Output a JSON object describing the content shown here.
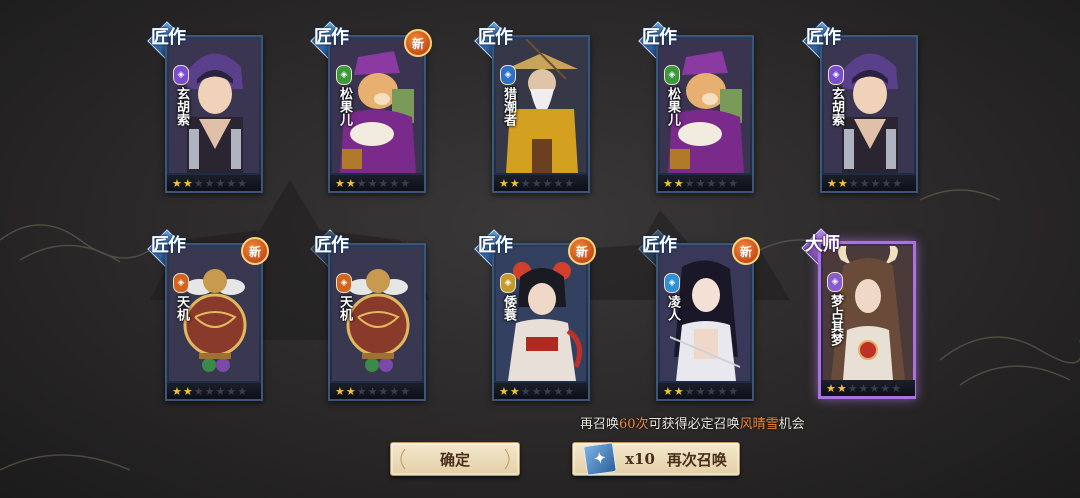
{
  "cards": [
    {
      "grade": "匠作",
      "name": "玄胡索",
      "element": "purple",
      "element_color": "#7a4ccf",
      "stars": 2,
      "max_stars": 7,
      "is_new": false,
      "portrait": "purple-haired-youth"
    },
    {
      "grade": "匠作",
      "name": "松果儿",
      "element": "green",
      "element_color": "#3a9a3a",
      "stars": 2,
      "max_stars": 7,
      "is_new": true,
      "portrait": "fox-merchant"
    },
    {
      "grade": "匠作",
      "name": "猎潮者",
      "element": "blue",
      "element_color": "#2f6fcc",
      "stars": 2,
      "max_stars": 7,
      "is_new": false,
      "portrait": "bearded-fisherman"
    },
    {
      "grade": "匠作",
      "name": "松果儿",
      "element": "green",
      "element_color": "#3a9a3a",
      "stars": 2,
      "max_stars": 7,
      "is_new": false,
      "portrait": "fox-merchant"
    },
    {
      "grade": "匠作",
      "name": "玄胡索",
      "element": "purple",
      "element_color": "#7a4ccf",
      "stars": 2,
      "max_stars": 7,
      "is_new": false,
      "portrait": "purple-haired-youth"
    },
    {
      "grade": "匠作",
      "name": "天机",
      "element": "orange",
      "element_color": "#d2641e",
      "stars": 2,
      "max_stars": 7,
      "is_new": true,
      "portrait": "bronze-automaton"
    },
    {
      "grade": "匠作",
      "name": "天机",
      "element": "orange",
      "element_color": "#d2641e",
      "stars": 2,
      "max_stars": 7,
      "is_new": false,
      "portrait": "bronze-automaton"
    },
    {
      "grade": "匠作",
      "name": "倭蓑",
      "element": "yellow",
      "element_color": "#c59a2a",
      "stars": 2,
      "max_stars": 7,
      "is_new": true,
      "portrait": "red-flower-girl"
    },
    {
      "grade": "匠作",
      "name": "凌人",
      "element": "blue",
      "element_color": "#2f8fd6",
      "stars": 2,
      "max_stars": 7,
      "is_new": true,
      "portrait": "dark-haired-woman"
    },
    {
      "grade": "大师",
      "name": "梦占其梦",
      "element": "purple",
      "element_color": "#8a5acf",
      "stars": 2,
      "max_stars": 7,
      "is_new": false,
      "portrait": "horned-sorceress"
    }
  ],
  "new_badge_label": "新",
  "hint": {
    "prefix": "再召唤",
    "count": "60次",
    "middle": "可获得必定召唤",
    "target": "风晴雪",
    "suffix": "机会"
  },
  "buttons": {
    "confirm_label": "确定",
    "resummon_count": "x10",
    "resummon_label": "再次召唤"
  },
  "colors": {
    "accent": "#f08a3a",
    "button_bg": "#f0e2c2",
    "master_border": "#a873e0",
    "normal_border": "#3d5578"
  }
}
